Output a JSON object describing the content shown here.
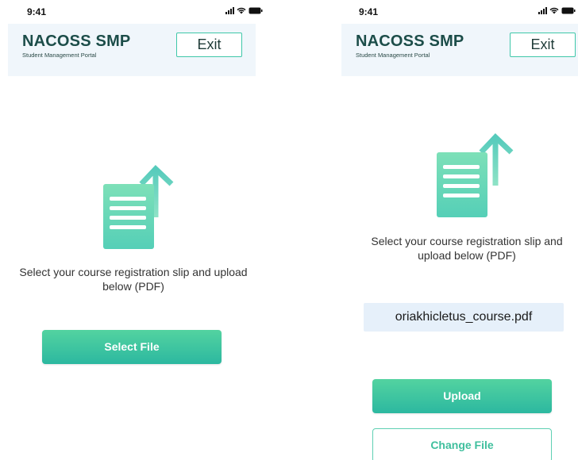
{
  "colors": {
    "brand_dark": "#1c4d49",
    "accent": "#3fc7a9",
    "header_bg": "#f0f6fb",
    "file_chip_bg": "#e6f0fa",
    "button_gradient_top": "#53d3a0",
    "button_gradient_bottom": "#2cb8a0"
  },
  "left_screen": {
    "status": {
      "time": "9:41",
      "icons": [
        "signal-icon",
        "wifi-icon",
        "battery-icon"
      ]
    },
    "header": {
      "title": "NACOSS SMP",
      "subtitle": "Student Management Portal",
      "exit_label": "Exit"
    },
    "icon": "document-upload-icon",
    "instructions": "Select your course registration slip and upload below (PDF)",
    "select_file_label": "Select File"
  },
  "right_screen": {
    "status": {
      "time": "9:41",
      "icons": [
        "signal-icon",
        "wifi-icon",
        "battery-icon"
      ]
    },
    "header": {
      "title": "NACOSS SMP",
      "subtitle": "Student Management Portal",
      "exit_label": "Exit"
    },
    "icon": "document-upload-icon",
    "instructions": "Select your course registration slip and upload below (PDF)",
    "selected_file": "oriakhicletus_course.pdf",
    "upload_label": "Upload",
    "change_file_label": "Change File"
  }
}
